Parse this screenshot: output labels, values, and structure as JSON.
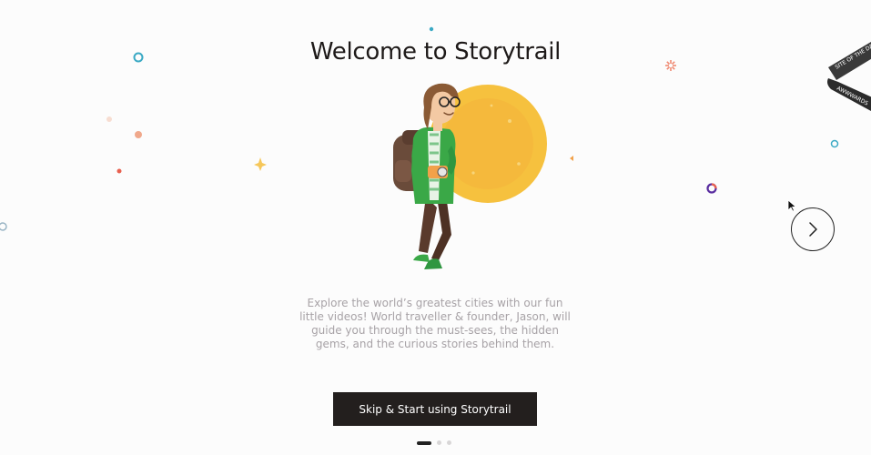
{
  "page": {
    "title": "Welcome to Storytrail",
    "description": "Explore the world’s greatest cities with our fun little videos! World traveller & founder, Jason, will guide you through the must-sees, the hidden gems, and the curious stories behind them.",
    "cta_label": "Skip & Start using Storytrail"
  },
  "pager": {
    "total": 3,
    "active_index": 0
  },
  "ribbon": {
    "line1": "SITE OF THE DAY",
    "line2": "AWWWARDS"
  },
  "icons": {
    "next": "chevron-right-icon",
    "illustration": "traveller-illustration"
  },
  "colors": {
    "cta_bg": "#231f1e",
    "title": "#1e1a19",
    "sun": "#f6c13e",
    "jacket": "#3aa847"
  }
}
